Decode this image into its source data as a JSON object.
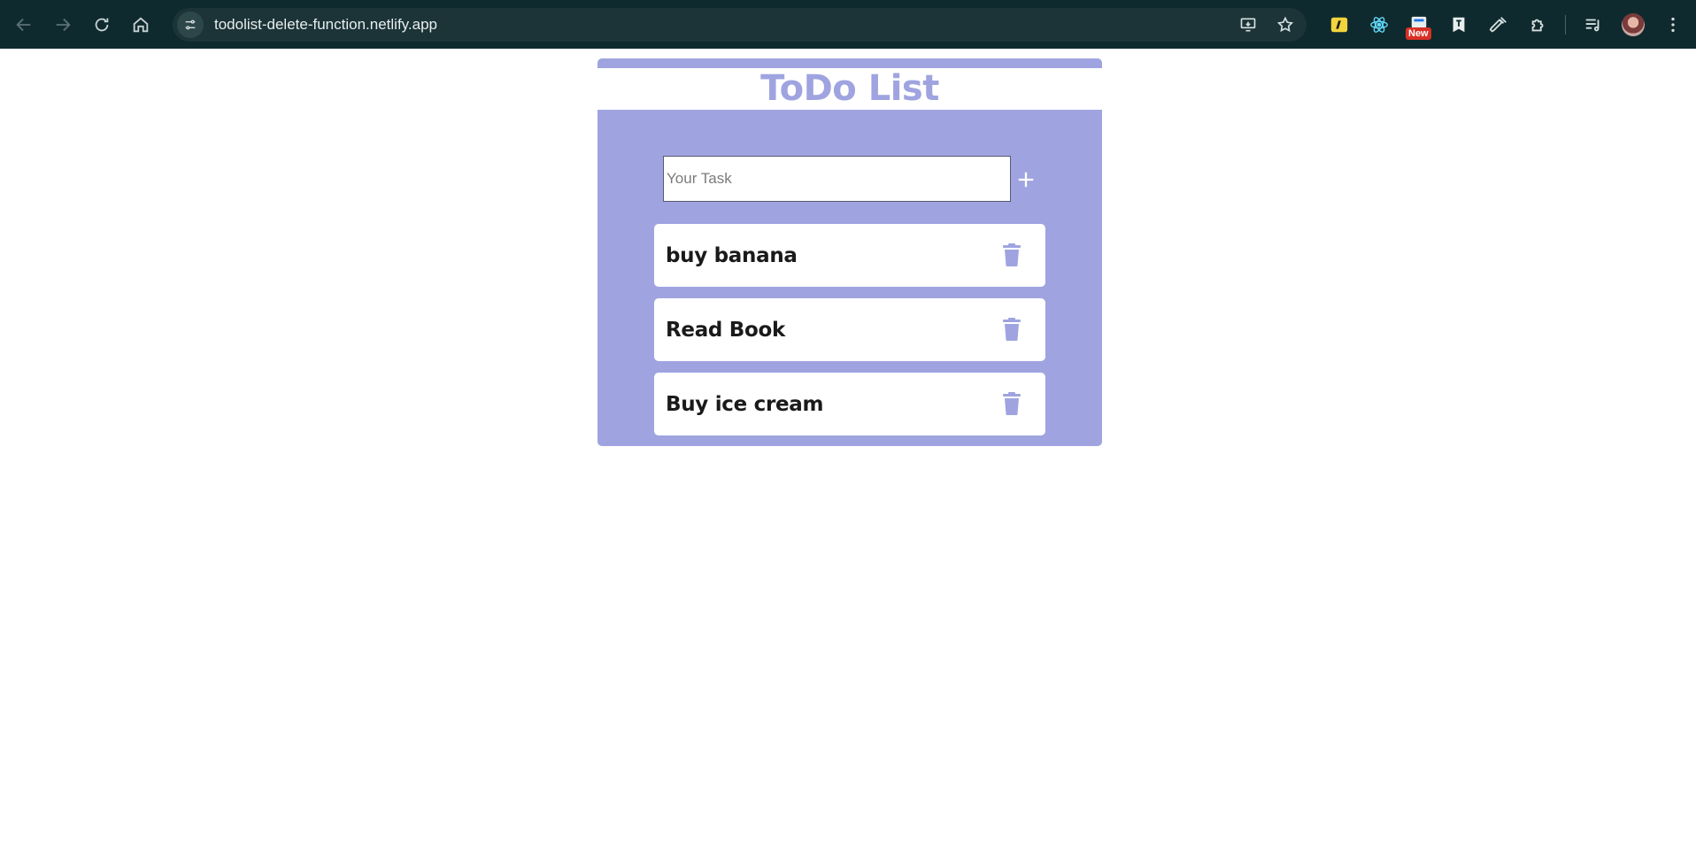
{
  "browser": {
    "url": "todolist-delete-function.netlify.app",
    "extension_badge": "New",
    "icons": [
      "back-icon",
      "forward-icon",
      "reload-icon",
      "home-icon",
      "site-info-icon",
      "install-icon",
      "bookmark-star-icon",
      "extension-icon",
      "react-devtools-icon",
      "new-badge-extension-icon",
      "reader-extension-icon",
      "color-picker-icon",
      "puzzle-extensions-icon",
      "media-playlist-icon",
      "profile-avatar",
      "menu-kebab-icon"
    ]
  },
  "app": {
    "title": "ToDo List",
    "input_placeholder": "Your Task",
    "accent_color": "#9fa4e0",
    "todos": [
      {
        "text": "buy banana"
      },
      {
        "text": "Read Book"
      },
      {
        "text": "Buy ice cream"
      }
    ]
  }
}
